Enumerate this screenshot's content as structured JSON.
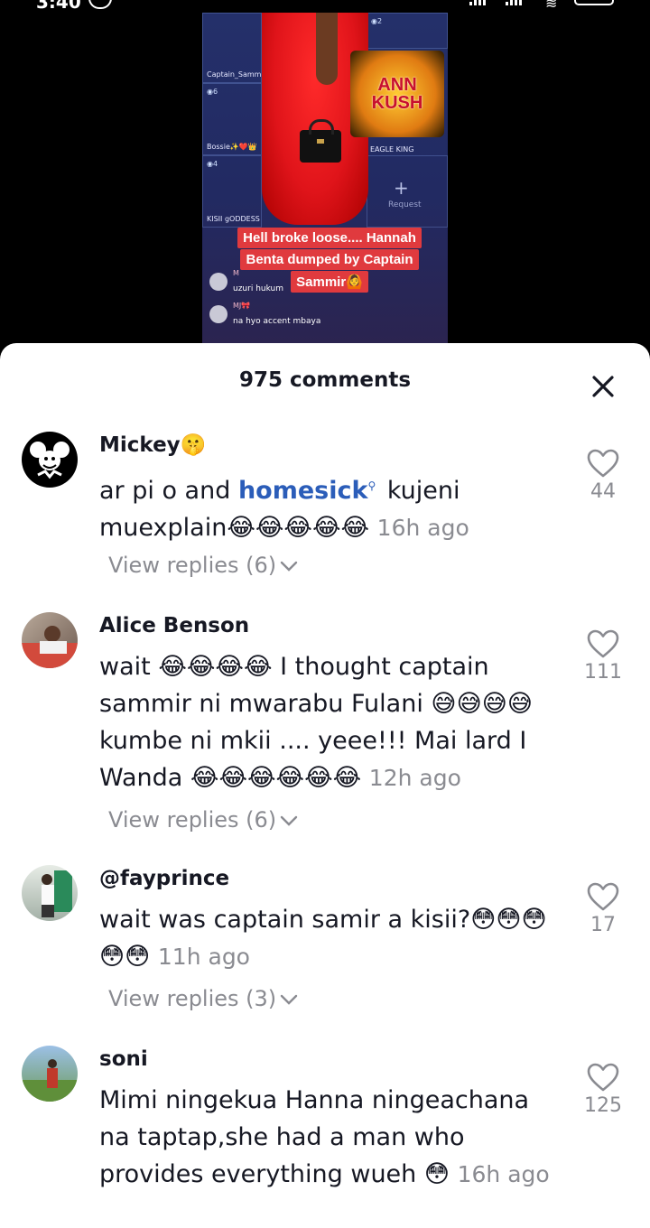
{
  "status_bar": {
    "time": "3:40"
  },
  "video": {
    "tiles": [
      {
        "name": "Captain_Sammir",
        "badge": ""
      },
      {
        "name": "Bossie✨❤️👑",
        "badge": "◉6"
      },
      {
        "name": "EAGLE KING",
        "badge": ""
      },
      {
        "name": "KISII gODDESS",
        "badge": "◉4"
      },
      {
        "name": "",
        "badge": "◉2"
      }
    ],
    "logo_text_1": "ANN",
    "logo_text_2": "KUSH",
    "logo_sub": "",
    "request_label": "Request",
    "caption_lines": [
      "Hell broke loose.... Hannah",
      "Benta dumped by Captain",
      "Sammir🙆"
    ],
    "live_comments": [
      {
        "user": "M",
        "text": "uzuri hukum"
      },
      {
        "user": "MJ🎀",
        "text": "na hyo accent mbaya"
      }
    ]
  },
  "sheet": {
    "title": "975 comments"
  },
  "comments": [
    {
      "username": "Mickey🤫",
      "mention": "homesick",
      "text_before": "ar pi o and ",
      "text_after": " kujeni muexplain",
      "emojis": "😂😂😂😂😂",
      "time": "16h ago",
      "likes": "44",
      "view_replies": "View replies (6)"
    },
    {
      "username": "Alice Benson",
      "text_a": "wait ",
      "emojis_a": "😂😂😂😂",
      "text_b": " I thought captain sammir ni mwarabu Fulani ",
      "emojis_b": "😅😅😅😅",
      "text_c": " kumbe ni mkii .... yeee!!! Mai lard I Wanda ",
      "emojis_c": "😂😂😂😂😂😂",
      "time": "12h ago",
      "likes": "111",
      "view_replies": "View replies (6)"
    },
    {
      "username": "@fayprince",
      "text_a": "wait was captain samir a kisii?",
      "emojis_a": "😳😳😳😳😳",
      "time": "11h ago",
      "likes": "17",
      "view_replies": "View replies (3)"
    },
    {
      "username": "soni",
      "text_a": "Mimi ningekua Hanna ningeachana na taptap,she had a man who provides everything wueh ",
      "emojis_a": "😳",
      "time": "16h ago",
      "likes": "125"
    }
  ]
}
